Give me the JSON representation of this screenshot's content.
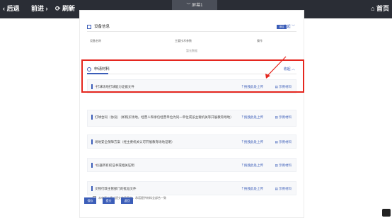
{
  "topbar": {
    "back_label": "‹ 后退",
    "forward_label": "前进 ›",
    "refresh_label": "⟳ 刷新",
    "screen_select_label": "﹀  屏幕1",
    "home_label": "⌂ 首页"
  },
  "equipment": {
    "title": "设备信息",
    "add_label": "添加",
    "collapse_label": "收起 ﹀",
    "columns": [
      "设备名称",
      "主要技术参数",
      "操作"
    ],
    "empty_text": "暂无数据"
  },
  "application": {
    "title": "申请材料",
    "collapse_label": "收起 ︿",
    "materials": [
      {
        "label": "打球场地打球能力证据文件",
        "required": "*",
        "upload": "⤒ 拖拽此处上传",
        "view": "▤ 示例材料"
      },
      {
        "label": "打球合同（协议）（如购买场地，经营人和承包经营单位为同一单位或该主要机关等开展教育场地）",
        "required": "",
        "upload": "⤒ 拖拽此处上传",
        "view": "▤ 示例材料"
      },
      {
        "label": "场地安全保障方案（经主要机关认可开展教育场地证明）",
        "required": "",
        "upload": "⤒ 拖拽此处上传",
        "view": "▤ 示例材料"
      },
      {
        "label": "仪器所有权证书或相关证明",
        "required": "*",
        "upload": "⤒ 拖拽此处上传",
        "view": "▤ 示例材料"
      },
      {
        "label": "文物行政主管部门的批准文件",
        "required": "",
        "upload": "⤒ 拖拽此处上传",
        "view": "▤ 示例材料"
      }
    ]
  },
  "agreement_text": "本申请人确认提交信息真实，承诺提供材料全部合一致",
  "buttons": {
    "save": "保存",
    "submit": "提交",
    "back": "返回"
  },
  "colors": {
    "accent": "#3b5db8",
    "annotation": "#e5271f",
    "topbar": "#2a2d35"
  }
}
